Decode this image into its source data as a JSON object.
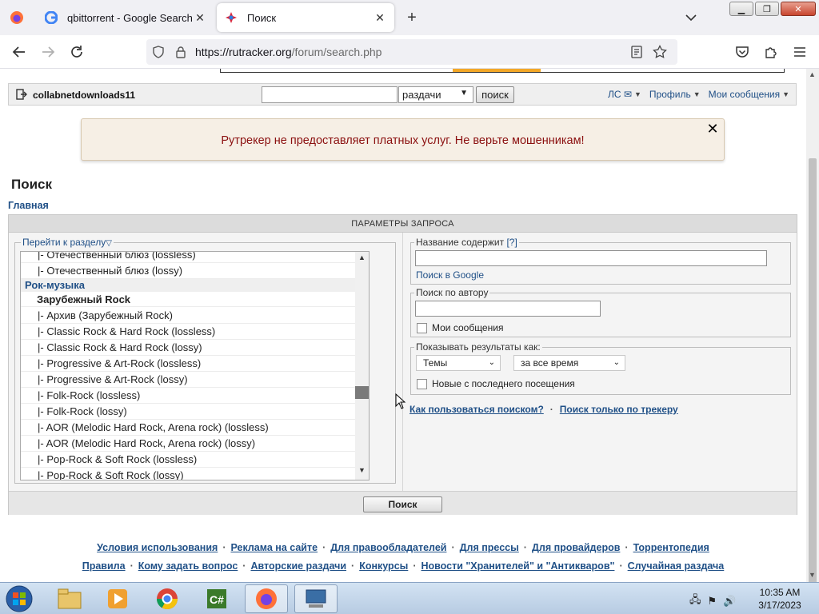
{
  "browser": {
    "tabs": [
      {
        "title": "qbittorrent - Google Search",
        "active": false
      },
      {
        "title": "Поиск",
        "active": true
      }
    ],
    "url_prefix": "https://rutracker.org",
    "url_path": "/forum/search.php"
  },
  "userbar": {
    "username": "collabnetdownloads11",
    "search_value": "",
    "category_selected": "раздачи",
    "search_button": "поиск",
    "links": {
      "messages_short": "ЛС ✉",
      "profile": "Профиль",
      "my_messages": "Мои сообщения"
    }
  },
  "warning": {
    "message": "Рутрекер не предоставляет платных услуг. Не верьте мошенникам!",
    "close": "✕"
  },
  "page_title": "Поиск",
  "breadcrumb": "Главная",
  "params": {
    "header": "ПАРАМЕТРЫ ЗАПРОСА",
    "section_legend": "Перейти к разделу",
    "forum_rows": [
      {
        "type": "item",
        "label": "|- Отечественный блюз (lossless)"
      },
      {
        "type": "item",
        "label": "|- Отечественный блюз (lossy)"
      },
      {
        "type": "group",
        "label": "Рок-музыка"
      },
      {
        "type": "sub",
        "label": "Зарубежный Rock"
      },
      {
        "type": "item",
        "label": "|- Архив (Зарубежный Rock)"
      },
      {
        "type": "item",
        "label": "|- Classic Rock & Hard Rock (lossless)"
      },
      {
        "type": "item",
        "label": "|- Classic Rock & Hard Rock (lossy)"
      },
      {
        "type": "item",
        "label": "|- Progressive & Art-Rock (lossless)"
      },
      {
        "type": "item",
        "label": "|- Progressive & Art-Rock (lossy)"
      },
      {
        "type": "item",
        "label": "|- Folk-Rock (lossless)"
      },
      {
        "type": "item",
        "label": "|- Folk-Rock (lossy)"
      },
      {
        "type": "item",
        "label": "|- AOR (Melodic Hard Rock, Arena rock) (lossless)"
      },
      {
        "type": "item",
        "label": "|- AOR (Melodic Hard Rock, Arena rock) (lossy)"
      },
      {
        "type": "item",
        "label": "|- Pop-Rock & Soft Rock (lossless)"
      },
      {
        "type": "item",
        "label": "|- Pop-Rock & Soft Rock (lossy)"
      }
    ],
    "title_contains": {
      "legend": "Название содержит",
      "help": "[?]",
      "value": "",
      "google_link": "Поиск в Google"
    },
    "author": {
      "legend": "Поиск по автору",
      "value": "",
      "my_messages": "Мои сообщения"
    },
    "show_as": {
      "legend": "Показывать результаты как:",
      "type_selected": "Темы",
      "period_selected": "за все время",
      "new_since_last": "Новые с последнего посещения"
    },
    "help_link": "Как пользоваться поиском?",
    "tracker_link": "Поиск только по трекеру",
    "search_button": "Поиск"
  },
  "footer": {
    "row1": [
      "Условия использования",
      "Реклама на сайте",
      "Для правообладателей",
      "Для прессы",
      "Для провайдеров",
      "Торрентопедия"
    ],
    "row2": [
      "Правила",
      "Кому задать вопрос",
      "Авторские раздачи",
      "Конкурсы",
      "Новости \"Хранителей\" и \"Антикваров\"",
      "Случайная раздача"
    ]
  },
  "taskbar": {
    "time": "10:35 AM",
    "date": "3/17/2023"
  },
  "colors": {
    "link": "#205087",
    "warning_text": "#8b1010",
    "warning_bg": "#f6efe5"
  }
}
